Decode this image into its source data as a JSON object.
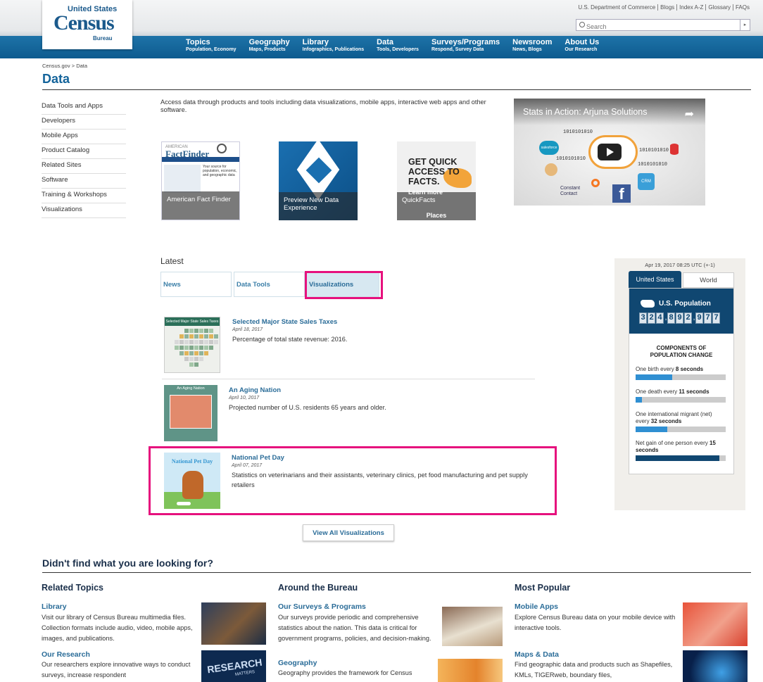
{
  "header": {
    "logo": {
      "line1": "United States",
      "line2": "Census",
      "line3": "Bureau"
    },
    "utility_links": [
      "U.S. Department of Commerce",
      "Blogs",
      "Index A-Z",
      "Glossary",
      "FAQs"
    ],
    "search_placeholder": "Search",
    "nav": [
      {
        "title": "Topics",
        "sub": "Population, Economy"
      },
      {
        "title": "Geography",
        "sub": "Maps, Products"
      },
      {
        "title": "Library",
        "sub": "Infographics, Publications"
      },
      {
        "title": "Data",
        "sub": "Tools, Developers"
      },
      {
        "title": "Surveys/Programs",
        "sub": "Respond, Survey Data"
      },
      {
        "title": "Newsroom",
        "sub": "News, Blogs"
      },
      {
        "title": "About Us",
        "sub": "Our Research"
      }
    ]
  },
  "breadcrumb": {
    "home": "Census.gov",
    "sep": ">",
    "current": "Data"
  },
  "page_title": "Data",
  "leftnav": [
    "Data Tools and Apps",
    "Developers",
    "Mobile Apps",
    "Product Catalog",
    "Related Sites",
    "Software",
    "Training & Workshops",
    "Visualizations"
  ],
  "intro": "Access data through products and tools including data visualizations, mobile apps, interactive web apps and other software.",
  "tiles": {
    "factfinder": {
      "caption": "American Fact Finder",
      "brand_small": "AMERICAN",
      "brand": "FactFinder",
      "blurb": "Your source for population, economic, and geographic data"
    },
    "preview": {
      "caption": "Preview New Data Experience"
    },
    "quickfacts": {
      "caption": "QuickFacts",
      "headline": "GET QUICK ACCESS TO FACTS.",
      "learn": "Learn more",
      "places": "Places"
    }
  },
  "video": {
    "title": "Stats in Action: Arjuna Solutions",
    "labels": {
      "salesforce": "salesforce",
      "crm": "CRM",
      "contact": "Constant Contact"
    },
    "binary": "1010101010"
  },
  "latest": {
    "heading": "Latest",
    "tabs": [
      "News",
      "Data Tools",
      "Visualizations"
    ],
    "items": [
      {
        "title": "Selected Major State Sales Taxes",
        "date": "April 18, 2017",
        "desc": "Percentage of total state revenue: 2016.",
        "thumb_title": "Selected Major State Sales Taxes"
      },
      {
        "title": "An Aging Nation",
        "date": "April 10, 2017",
        "desc": "Projected number of U.S. residents 65 years and older.",
        "thumb_title": "An Aging Nation"
      },
      {
        "title": "National Pet Day",
        "date": "April 07, 2017",
        "desc": "Statistics on veterinarians and their assistants, veterinary clinics, pet food manufacturing and pet supply retailers",
        "thumb_title": "National Pet Day"
      }
    ],
    "view_all": "View All Visualizations"
  },
  "popclock": {
    "timestamp": "Apr 19, 2017 08:25 UTC (+-1)",
    "tabs": [
      "United States",
      "World"
    ],
    "label": "U.S. Population",
    "digits": [
      "3",
      "2",
      "4",
      "8",
      "9",
      "2",
      "9",
      "7",
      "7"
    ],
    "heading": "COMPONENTS OF POPULATION CHANGE",
    "components": [
      {
        "pre": "One birth every ",
        "bold": "8 seconds",
        "fill": 0.41
      },
      {
        "pre": "One death every ",
        "bold": "11 seconds",
        "fill": 0.07
      },
      {
        "pre": "One international migrant (net) every ",
        "bold": "32 seconds",
        "fill": 0.35
      },
      {
        "pre": "Net gain of one person every ",
        "bold": "15 seconds",
        "fill": 0.93
      }
    ]
  },
  "bottom": {
    "heading": "Didn't find what you are looking for?",
    "columns": [
      {
        "title": "Related Topics",
        "entries": [
          {
            "title": "Library",
            "desc": "Visit our library of Census Bureau multimedia files. Collection formats include audio, video, mobile apps, images, and publications."
          },
          {
            "title": "Our Research",
            "desc": "Our researchers explore innovative ways to conduct surveys, increase respondent"
          }
        ]
      },
      {
        "title": "Around the Bureau",
        "entries": [
          {
            "title": "Our Surveys & Programs",
            "desc": "Our surveys provide periodic and comprehensive statistics about the nation. This data is critical for government programs, policies, and decision-making."
          },
          {
            "title": "Geography",
            "desc": "Geography provides the framework for Census"
          }
        ]
      },
      {
        "title": "Most Popular",
        "entries": [
          {
            "title": "Mobile Apps",
            "desc": "Explore Census Bureau data on your mobile device with interactive tools."
          },
          {
            "title": "Maps & Data",
            "desc": "Find geographic data and products such as Shapefiles, KMLs, TIGERweb, boundary files,"
          }
        ]
      }
    ],
    "research_img_text": "RESEARCH",
    "research_img_sub": "MATTERS"
  },
  "colors": {
    "accent": "#e6117d",
    "navy": "#104771",
    "link": "#2a6c98"
  }
}
